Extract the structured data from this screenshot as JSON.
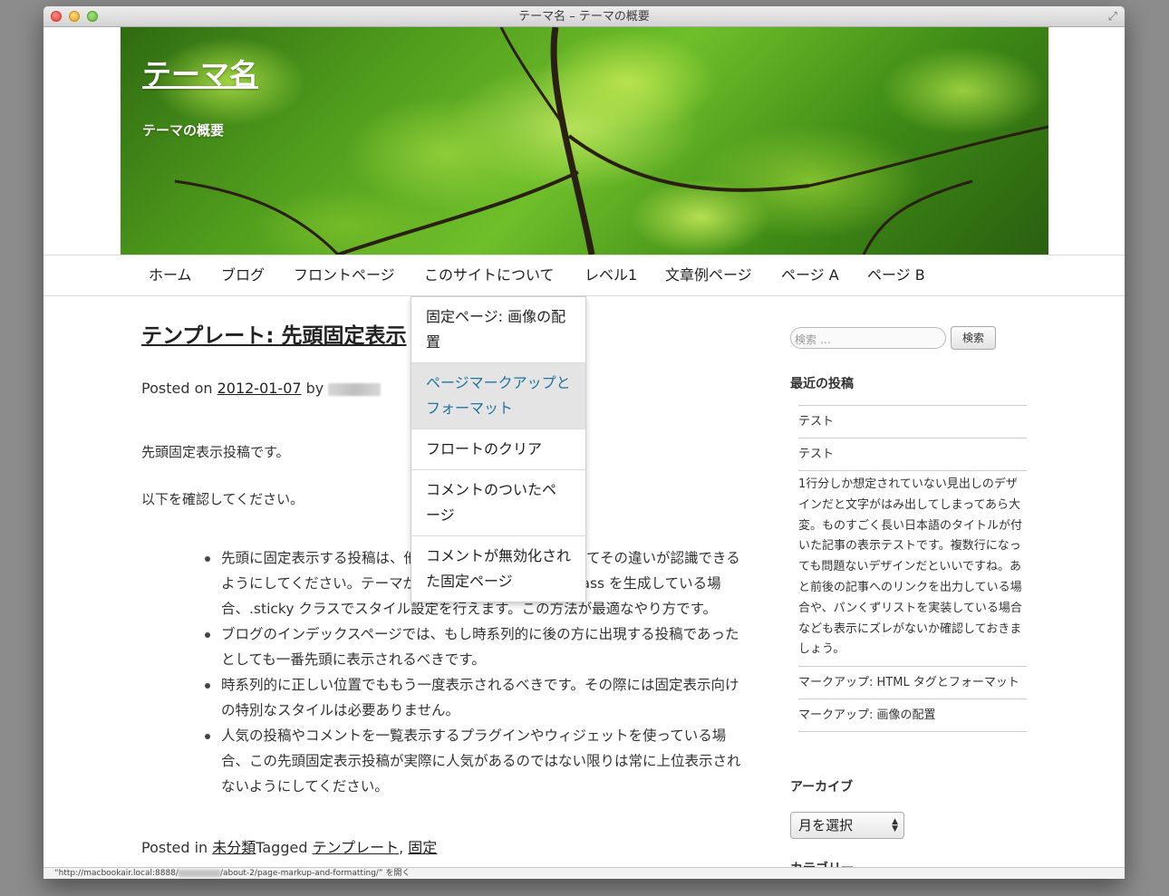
{
  "window": {
    "title": "テーマ名 – テーマの概要"
  },
  "site": {
    "title": "テーマ名",
    "description": "テーマの概要"
  },
  "nav": {
    "items": [
      "ホーム",
      "ブログ",
      "フロントページ",
      "このサイトについて",
      "レベル1",
      "文章例ページ",
      "ページ A",
      "ページ B"
    ]
  },
  "dropdown": {
    "items": [
      "固定ページ: 画像の配置",
      "ページマークアップとフォーマット",
      "フロートのクリア",
      "コメントのついたページ",
      "コメントが無効化された固定ページ"
    ],
    "active_index": 1
  },
  "post": {
    "title": "テンプレート: 先頭固定表示",
    "meta_prefix": "Posted on ",
    "date": "2012-01-07",
    "by": " by ",
    "intro": "先頭固定表示投稿です。",
    "check": "以下を確認してください。",
    "bullets": [
      "先頭に固定表示する投稿は、他の投稿と見た目に差をつけてその違いが認識できるようにしてください。テーマが post_class() で投稿の class を生成している場合、.sticky クラスでスタイル設定を行えます。この方法が最適なやり方です。",
      "ブログのインデックスページでは、もし時系列的に後の方に出現する投稿であったとしても一番先頭に表示されるべきです。",
      "時系列的に正しい位置でももう一度表示されるべきです。その際には固定表示向けの特別なスタイルは必要ありません。",
      "人気の投稿やコメントを一覧表示するプラグインやウィジェットを使っている場合、この先頭固定表示投稿が実際に人気があるのではない限りは常に上位表示されないようにしてください。"
    ],
    "footer": {
      "posted_in": "Posted in ",
      "category": "未分類",
      "tagged": "Tagged ",
      "tag1": "テンプレート",
      "sep": ", ",
      "tag2": "固定"
    }
  },
  "sidebar": {
    "search_placeholder": "検索 …",
    "search_button": "検索",
    "recent_title": "最近の投稿",
    "recent": [
      "テスト",
      "テスト",
      "1行分しか想定されていない見出しのデザインだと文字がはみ出してしまってあら大変。ものすごく長い日本語のタイトルが付いた記事の表示テストです。複数行になっても問題ないデザインだといいですね。あと前後の記事へのリンクを出力している場合や、パンくずリストを実装している場合なども表示にズレがないか確認しておきましょう。",
      "マークアップ: HTML タグとフォーマット",
      "マークアップ: 画像の配置"
    ],
    "archive_title": "アーカイブ",
    "archive_select": "月を選択",
    "category_title": "カテゴリー"
  },
  "statusbar": {
    "prefix": "“http://macbookair.local:8888/",
    "suffix": "/about-2/page-markup-and-formatting/” を開く"
  }
}
